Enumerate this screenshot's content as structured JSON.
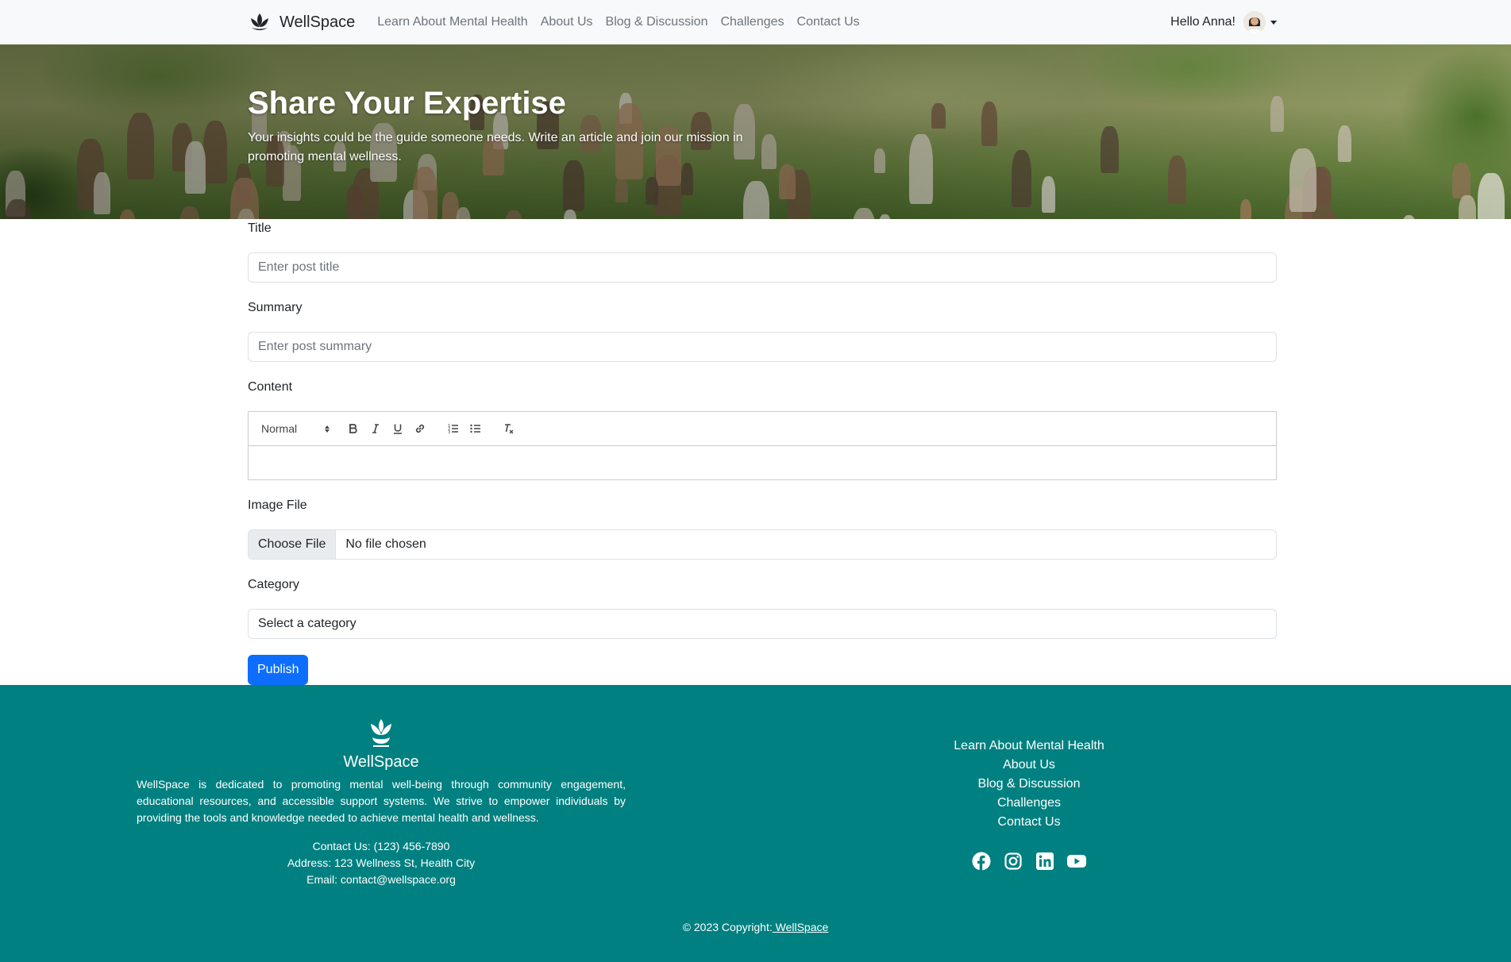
{
  "nav": {
    "brand": "WellSpace",
    "links": [
      "Learn About Mental Health",
      "About Us",
      "Blog & Discussion",
      "Challenges",
      "Contact Us"
    ],
    "greeting": "Hello Anna!"
  },
  "hero": {
    "title": "Share Your Expertise",
    "subtitle": "Your insights could be the guide someone needs. Write an article and join our mission in promoting mental wellness."
  },
  "form": {
    "title_label": "Title",
    "title_placeholder": "Enter post title",
    "summary_label": "Summary",
    "summary_placeholder": "Enter post summary",
    "content_label": "Content",
    "editor": {
      "format_select": "Normal",
      "tools": [
        "bold",
        "italic",
        "underline",
        "link",
        "ordered-list",
        "bullet-list",
        "clean"
      ]
    },
    "image_label": "Image File",
    "file_button": "Choose File",
    "file_status": "No file chosen",
    "category_label": "Category",
    "category_selected": "Select a category",
    "submit_label": "Publish"
  },
  "footer": {
    "brand": "WellSpace",
    "description": "WellSpace is dedicated to promoting mental well-being through community engagement, educational resources, and accessible support systems. We strive to empower individuals by providing the tools and knowledge needed to achieve mental health and wellness.",
    "phone": "Contact Us: (123) 456-7890",
    "address": "Address: 123 Wellness St, Health City",
    "email": "Email: contact@wellspace.org",
    "links": [
      "Learn About Mental Health",
      "About Us",
      "Blog & Discussion",
      "Challenges",
      "Contact Us"
    ],
    "social": [
      "facebook-icon",
      "instagram-icon",
      "linkedin-icon",
      "youtube-icon"
    ],
    "copyright_prefix": "© 2023 Copyright:",
    "copyright_link": " WellSpace"
  },
  "colors": {
    "navbar_bg": "#f8f9fa",
    "primary": "#0d6efd",
    "footer_bg": "#008080"
  }
}
